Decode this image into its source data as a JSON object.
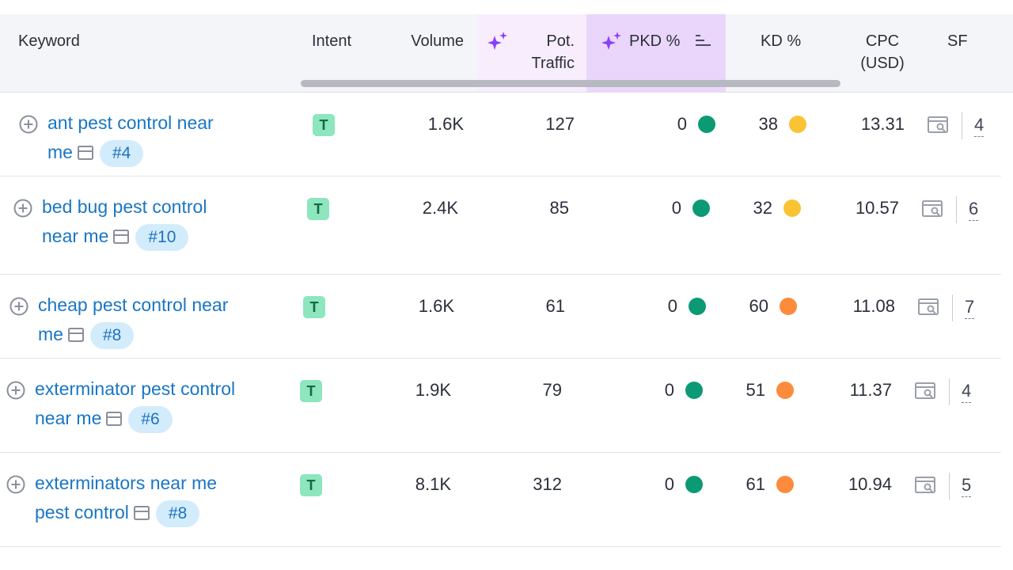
{
  "table": {
    "headers": {
      "keyword": "Keyword",
      "intent": "Intent",
      "volume": "Volume",
      "pot_traffic_l1": "Pot.",
      "pot_traffic_l2": "Traffic",
      "pkd": "PKD %",
      "kd": "KD %",
      "cpc_l1": "CPC",
      "cpc_l2": "(USD)",
      "sf": "SF"
    },
    "rows": [
      {
        "kw1": "ant pest control near",
        "kw2": "me",
        "position": "#4",
        "intent": "T",
        "volume": "1.6K",
        "traffic": "127",
        "pkd": "0",
        "pkd_color": "#0b9a74",
        "kd": "38",
        "kd_color": "#f9c333",
        "cpc": "13.31",
        "sf": "4"
      },
      {
        "kw1": "bed bug pest control",
        "kw2": "near me",
        "position": "#10",
        "intent": "T",
        "volume": "2.4K",
        "traffic": "85",
        "pkd": "0",
        "pkd_color": "#0b9a74",
        "kd": "32",
        "kd_color": "#f9c333",
        "cpc": "10.57",
        "sf": "6"
      },
      {
        "kw1": "cheap pest control near",
        "kw2": "me",
        "position": "#8",
        "intent": "T",
        "volume": "1.6K",
        "traffic": "61",
        "pkd": "0",
        "pkd_color": "#0b9a74",
        "kd": "60",
        "kd_color": "#fd8b3c",
        "cpc": "11.08",
        "sf": "7"
      },
      {
        "kw1": "exterminator pest control",
        "kw2": "near me",
        "position": "#6",
        "intent": "T",
        "volume": "1.9K",
        "traffic": "79",
        "pkd": "0",
        "pkd_color": "#0b9a74",
        "kd": "51",
        "kd_color": "#fd8b3c",
        "cpc": "11.37",
        "sf": "4"
      },
      {
        "kw1": "exterminators near me",
        "kw2": "pest control",
        "position": "#8",
        "intent": "T",
        "volume": "8.1K",
        "traffic": "312",
        "pkd": "0",
        "pkd_color": "#0b9a74",
        "kd": "61",
        "kd_color": "#fd8b3c",
        "cpc": "10.94",
        "sf": "5"
      }
    ]
  },
  "icons": {
    "add": "plus-circle-icon",
    "serp": "serp-snapshot-icon",
    "sf": "serp-features-icon",
    "ai": "sparkle-icon",
    "sort": "sort-icon"
  },
  "colors": {
    "keyword_link": "#1976c5",
    "pkd_header_bg": "#ead6fb",
    "intent_badge": "#8de6bd",
    "position_badge": "#d3ecfc"
  }
}
